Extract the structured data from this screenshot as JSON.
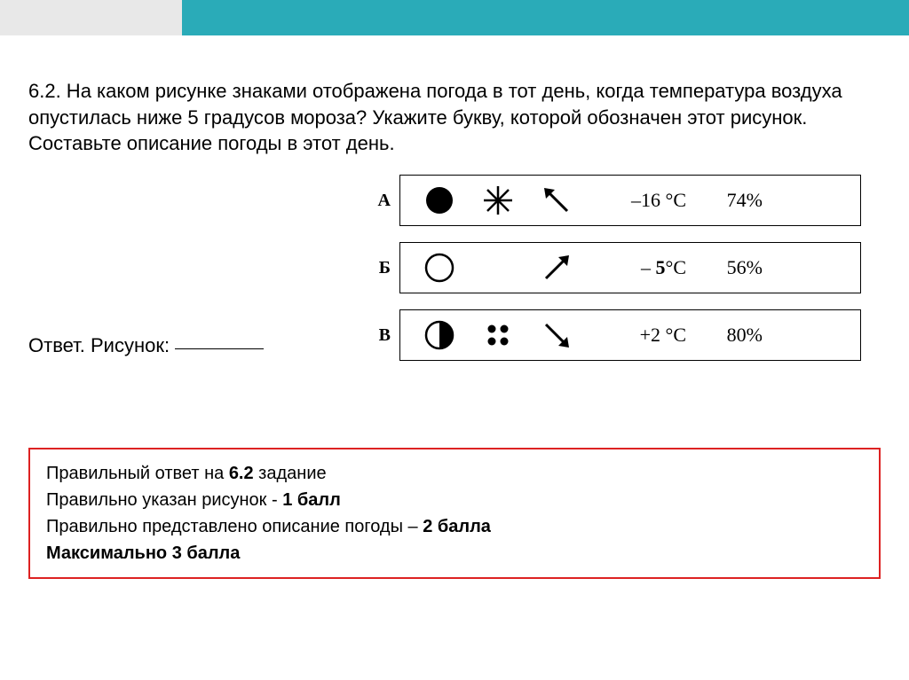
{
  "question": "6.2. На каком рисунке знаками отображена погода в тот день, когда температура воздуха опустилась ниже 5 градусов мороза? Укажите букву, которой обозначен этот рисунок. Составьте описание погоды в этот день.",
  "answerLabel": "Ответ. Рисунок:",
  "rows": {
    "a": {
      "label": "А",
      "temp": "–16 °C",
      "hum": "74%"
    },
    "b": {
      "label": "Б",
      "temp_prefix": "–  ",
      "temp_bold": "5",
      "temp_suffix": "°C",
      "hum": "56%"
    },
    "c": {
      "label": "В",
      "temp": "+2 °C",
      "hum": "80%"
    }
  },
  "scoring": {
    "l1a": "Правильный ответ на ",
    "l1b": "6.2",
    "l1c": " задание",
    "l2a": "Правильно указан рисунок - ",
    "l2b": "1 балл",
    "l3a": "Правильно представлено описание погоды – ",
    "l3b": "2 балла",
    "l4": "Максимально 3 балла"
  }
}
